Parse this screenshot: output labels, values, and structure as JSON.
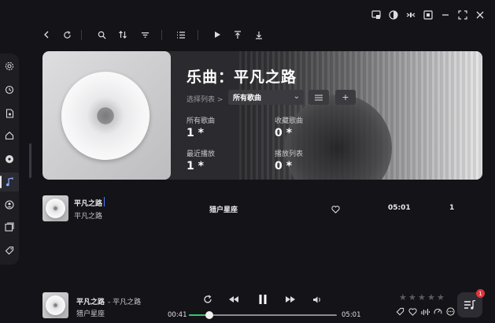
{
  "window": {
    "controls": [
      "mini-player-icon",
      "theme-icon",
      "fullscreen-icon",
      "lyrics-icon",
      "minimize-icon",
      "maximize-icon",
      "close-icon"
    ]
  },
  "toolbar": {
    "icons": [
      "back-icon",
      "refresh-icon",
      "search-icon",
      "sort-icon",
      "filter-icon",
      "list-icon",
      "play-icon",
      "scroll-top-icon",
      "scroll-bottom-icon"
    ]
  },
  "sidebar": {
    "icons": [
      "settings-icon",
      "history-icon",
      "local-file-icon",
      "home-icon",
      "disc-icon",
      "music-note-icon",
      "artist-icon",
      "album-icon",
      "tag-icon"
    ],
    "active_index": 5
  },
  "hero": {
    "title": "乐曲：平凡之路",
    "select_label": "选择列表 >",
    "select_value": "所有歌曲",
    "stats": [
      {
        "label": "所有歌曲",
        "value": "1 *"
      },
      {
        "label": "收藏歌曲",
        "value": "0 *"
      },
      {
        "label": "最近播放",
        "value": "1 *"
      },
      {
        "label": "播放列表",
        "value": "0 *"
      }
    ]
  },
  "track_row": {
    "title": "平凡之路",
    "album": "平凡之路",
    "artist": "猎户星座",
    "duration": "05:01",
    "play_count": "1"
  },
  "player": {
    "title": "平凡之路",
    "title_suffix": "- 平凡之路",
    "artist": "猎户星座",
    "elapsed": "00:41",
    "total": "05:01",
    "progress": 0.136,
    "rating": 0,
    "queue_badge": "1",
    "accent": "#35c56a"
  }
}
